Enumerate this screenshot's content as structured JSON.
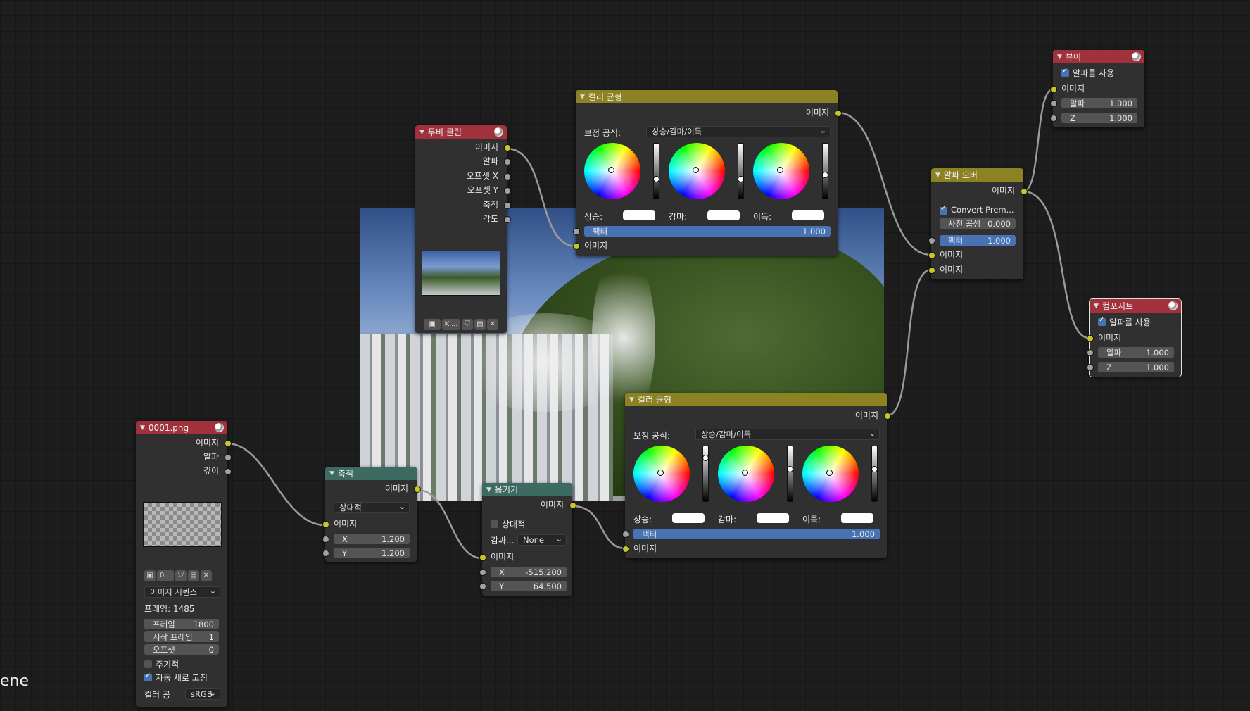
{
  "colors": {
    "accent": "#4772b3",
    "output_header": "#a1313a",
    "color_header": "#8c8123",
    "distort_header": "#3d6b61",
    "socket_image": "#c7c729",
    "socket_value": "#a1a1a1"
  },
  "corner_text": "ene",
  "image_node": {
    "title": "0001.png",
    "outputs": [
      "이미지",
      "알파",
      "깊이"
    ],
    "file_field": "0...",
    "source": "이미지 시퀀스",
    "frame_info": "프레임: 1485",
    "fields": [
      {
        "label": "프레임",
        "value": "1800"
      },
      {
        "label": "시작 프레임",
        "value": "1"
      },
      {
        "label": "오프셋",
        "value": "0"
      }
    ],
    "cyclic": "주기적",
    "auto_refresh": "자동 새로 고침",
    "color_space_label": "컬러 공",
    "color_space": "sRGB"
  },
  "scale_node": {
    "title": "축적",
    "output": "이미지",
    "space": "상대적",
    "input": "이미지",
    "x_label": "X",
    "x": "1.200",
    "y_label": "Y",
    "y": "1.200"
  },
  "translate_node": {
    "title": "옮기기",
    "output": "이미지",
    "relative": "상대적",
    "wrap_label": "감싸...",
    "wrap": "None",
    "input": "이미지",
    "x_label": "X",
    "x": "-515.200",
    "y_label": "Y",
    "y": "64.500"
  },
  "movie_node": {
    "title": "무비 클립",
    "outputs": [
      "이미지",
      "알파",
      "오프셋 X",
      "오프셋 Y",
      "축적",
      "각도"
    ],
    "clip_field": "Kl..."
  },
  "cb_top": {
    "title": "컬러 균형",
    "output": "이미지",
    "formula_label": "보정 공식:",
    "formula": "상승/감마/이득",
    "lift": "상승:",
    "gamma": "감마:",
    "gain": "이득:",
    "factor_label": "팩터",
    "factor": "1.000",
    "input": "이미지"
  },
  "cb_bottom": {
    "title": "컬러 균형",
    "output": "이미지",
    "formula_label": "보정 공식:",
    "formula": "상승/감마/이득",
    "lift": "상승:",
    "gamma": "감마:",
    "gain": "이득:",
    "factor_label": "팩터",
    "factor": "1.000",
    "input": "이미지"
  },
  "alpha_over": {
    "title": "알파 오버",
    "output": "이미지",
    "convert": "Convert Prem...",
    "premul_label": "사전 곱셈",
    "premul": "0.000",
    "factor_label": "팩터",
    "factor": "1.000",
    "inputs": [
      "이미지",
      "이미지"
    ]
  },
  "viewer": {
    "title": "뷰어",
    "use_alpha": "알파를 사용",
    "input": "이미지",
    "alpha_label": "알파",
    "alpha": "1.000",
    "z_label": "Z",
    "z": "1.000"
  },
  "composite": {
    "title": "컴포지트",
    "use_alpha": "알파를 사용",
    "input": "이미지",
    "alpha_label": "알파",
    "alpha": "1.000",
    "z_label": "Z",
    "z": "1.000"
  }
}
